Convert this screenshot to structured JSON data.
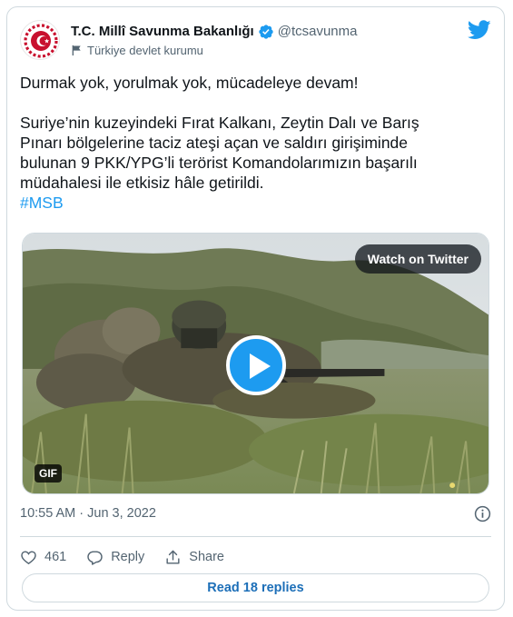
{
  "header": {
    "display_name": "T.C. Millî Savunma Bakanlığı",
    "handle": "@tcsavunma",
    "label": "Türkiye devlet kurumu"
  },
  "tweet": {
    "line1": "Durmak yok, yorulmak yok, mücadeleye devam!",
    "body": "Suriye’nin kuzeyindeki Fırat Kalkanı, Zeytin Dalı ve Barış\nPınarı bölgelerine taciz ateşi açan ve saldırı girişiminde\nbulunan 9 PKK/YPG’li terörist Komandolarımızın başarılı\nmüdahalesi ile etkisiz hâle getirildi.",
    "hashtag": "#MSB"
  },
  "media": {
    "watch_label": "Watch on Twitter",
    "badge": "GIF"
  },
  "meta": {
    "timestamp": "10:55 AM · Jun 3, 2022"
  },
  "actions": {
    "likes": "461",
    "reply_label": "Reply",
    "share_label": "Share"
  },
  "footer": {
    "read_replies": "Read 18 replies"
  },
  "colors": {
    "accent": "#1d9bf0",
    "muted": "#536471"
  },
  "icons": [
    "ministry-logo-icon",
    "verified-badge-icon",
    "government-flag-icon",
    "twitter-bird-icon",
    "play-icon",
    "info-icon",
    "heart-icon",
    "reply-icon",
    "share-icon"
  ]
}
